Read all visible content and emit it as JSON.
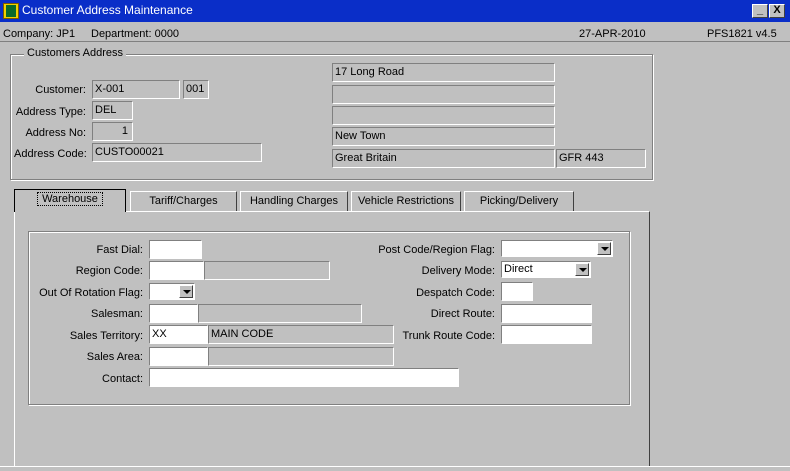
{
  "window": {
    "title": "Customer Address Maintenance",
    "minimize_label": "_",
    "close_label": "X"
  },
  "info": {
    "company": "Company: JP1",
    "department": "Department: 0000",
    "date": "27-APR-2010",
    "program": "PFS1821  v4.5"
  },
  "customers_address": {
    "group_title": "Customers Address",
    "customer_label": "Customer:",
    "customer_value": "X-001",
    "customer_suffix": "001",
    "address_type_label": "Address Type:",
    "address_type_value": "DEL",
    "address_no_label": "Address No:",
    "address_no_value": "1",
    "address_code_label": "Address Code:",
    "address_code_value": "CUSTO00021",
    "address_lines": [
      "17 Long Road",
      "",
      "",
      "New Town",
      "Great Britain"
    ],
    "postcode": "GFR 443"
  },
  "tabs": [
    {
      "label": "Warehouse",
      "active": true
    },
    {
      "label": "Tariff/Charges",
      "active": false
    },
    {
      "label": "Handling Charges",
      "active": false
    },
    {
      "label": "Vehicle  Restrictions",
      "active": false
    },
    {
      "label": "Picking/Delivery",
      "active": false
    }
  ],
  "warehouse": {
    "fast_dial_label": "Fast Dial:",
    "fast_dial_value": "",
    "region_code_label": "Region Code:",
    "region_code_value": "",
    "region_code_desc": "",
    "out_of_rotation_label": "Out Of Rotation Flag:",
    "out_of_rotation_value": "",
    "salesman_label": "Salesman:",
    "salesman_value": "",
    "salesman_desc": "",
    "sales_territory_label": "Sales Territory:",
    "sales_territory_value": "XX",
    "sales_territory_desc": "MAIN CODE",
    "sales_area_label": "Sales Area:",
    "sales_area_value": "",
    "sales_area_desc": "",
    "contact_label": "Contact:",
    "contact_value": "",
    "post_code_region_flag_label": "Post Code/Region Flag:",
    "post_code_region_flag_value": "",
    "delivery_mode_label": "Delivery Mode:",
    "delivery_mode_value": "Direct",
    "despatch_code_label": "Despatch Code:",
    "despatch_code_value": "",
    "direct_route_label": "Direct Route:",
    "direct_route_value": "",
    "trunk_route_code_label": "Trunk Route Code:",
    "trunk_route_code_value": ""
  }
}
